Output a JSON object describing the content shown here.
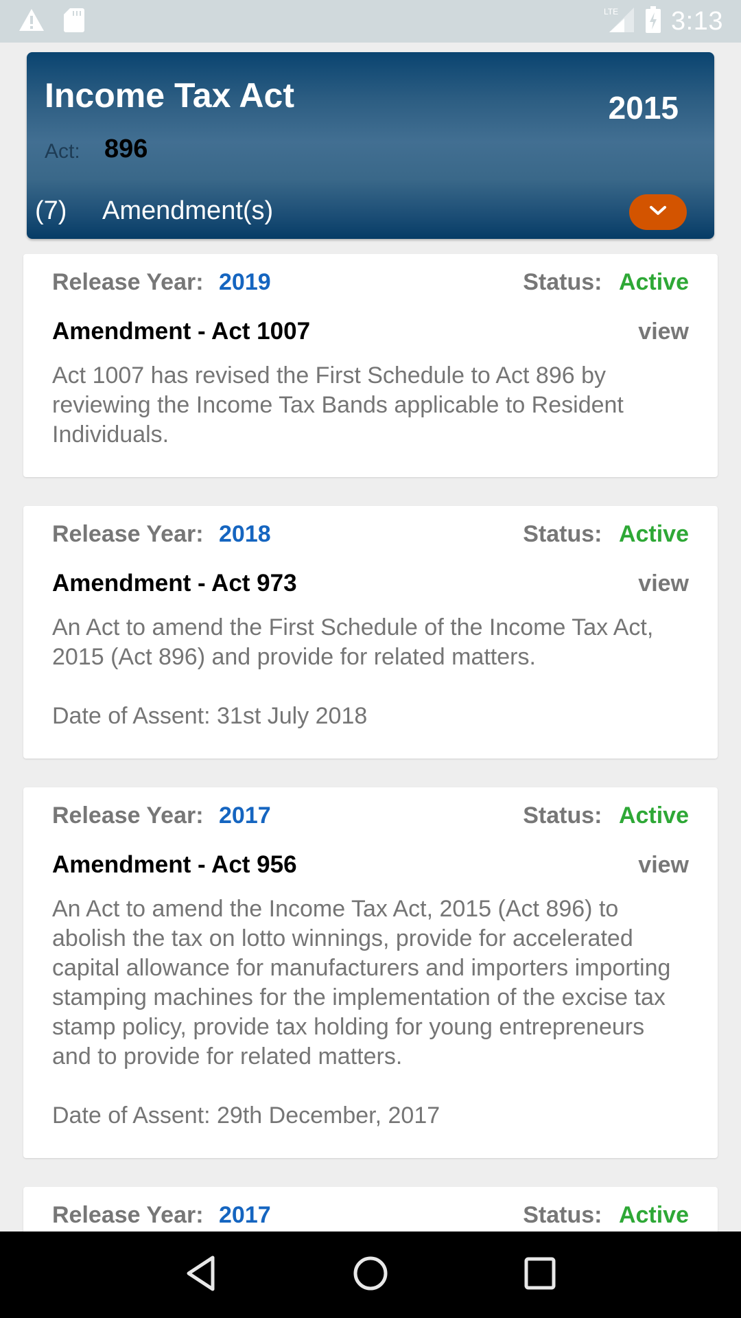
{
  "status_bar": {
    "left_icons": [
      "warning-icon",
      "sd-card-icon"
    ],
    "network": "LTE",
    "right_icons": [
      "signal-icon",
      "battery-charging-icon"
    ],
    "time": "3:13"
  },
  "header": {
    "title": "Income Tax Act",
    "year": "2015",
    "act_label": "Act:",
    "act_number": "896",
    "amendment_count": "(7)",
    "amendment_label": "Amendment(s)",
    "toggle_icon": "chevron-down-icon"
  },
  "labels": {
    "release_year": "Release Year:",
    "status": "Status:",
    "view": "view"
  },
  "colors": {
    "accent_orange": "#d35400",
    "header_blue": "#2c5d82",
    "year_blue": "#1565c0",
    "status_green": "#2ea836"
  },
  "amendments": [
    {
      "release_year": "2019",
      "status": "Active",
      "title": "Amendment - Act 1007",
      "description": "Act 1007 has revised the First Schedule to Act 896 by reviewing the Income Tax Bands applicable to Resident Individuals.",
      "assent": ""
    },
    {
      "release_year": "2018",
      "status": "Active",
      "title": "Amendment - Act 973",
      "description": "An Act to amend the First Schedule of the Income Tax Act, 2015 (Act 896) and provide for related matters.",
      "assent": "Date of Assent: 31st July 2018"
    },
    {
      "release_year": "2017",
      "status": "Active",
      "title": "Amendment - Act 956",
      "description": "An Act to amend the Income Tax Act, 2015 (Act 896) to abolish the tax on lotto winnings, provide for accelerated capital allowance for manufacturers and importers importing stamping machines for the implementation of the excise tax stamp policy, provide tax holding for young entrepreneurs and to provide for related matters.",
      "assent": "Date of Assent: 29th December, 2017"
    },
    {
      "release_year": "2017",
      "status": "Active"
    }
  ],
  "nav_bar": {
    "buttons": [
      "back-icon",
      "home-icon",
      "recents-icon"
    ]
  }
}
